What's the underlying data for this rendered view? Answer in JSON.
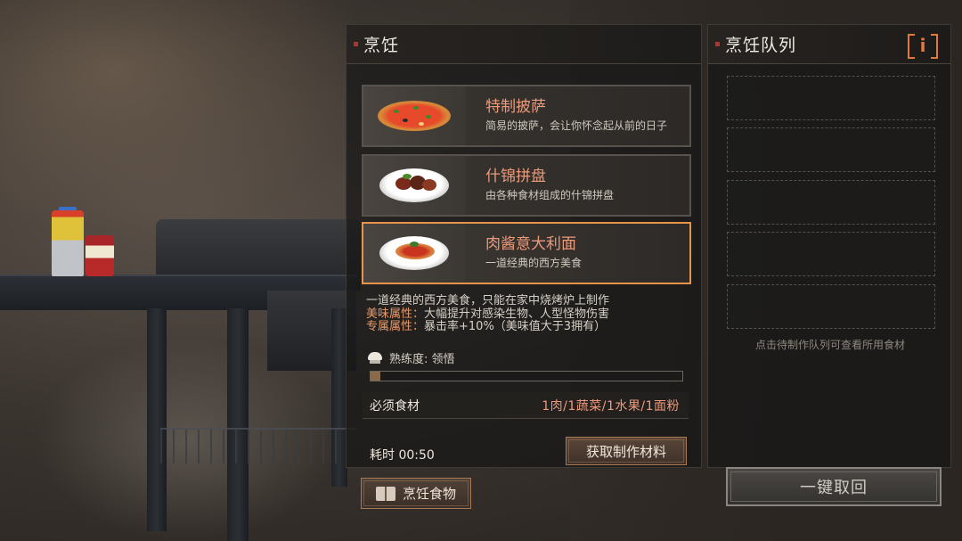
{
  "cook_panel": {
    "title": "烹饪",
    "recipes": [
      {
        "name": "特制披萨",
        "desc": "简易的披萨，会让你怀念起从前的日子",
        "icon": "pizza-icon",
        "selected": false
      },
      {
        "name": "什锦拼盘",
        "desc": "由各种食材组成的什锦拼盘",
        "icon": "platter-icon",
        "selected": false
      },
      {
        "name": "肉酱意大利面",
        "desc": "一道经典的西方美食",
        "icon": "spaghetti-icon",
        "selected": true
      }
    ],
    "detail": {
      "description": "一道经典的西方美食，只能在家中烧烤炉上制作",
      "attr1_label": "美味属性：",
      "attr1_value": "大幅提升对感染生物、人型怪物伤害",
      "attr2_label": "专属属性：",
      "attr2_value": "暴击率+10%（美味值大于3拥有）"
    },
    "proficiency": {
      "label": "熟练度: 领悟",
      "progress": 0.03
    },
    "ingredients": {
      "label": "必须食材",
      "value": "1肉/1蔬菜/1水果/1面粉"
    },
    "time": "耗时 00:50",
    "get_materials_button": "获取制作材料",
    "cook_button": "烹饪食物"
  },
  "queue_panel": {
    "title": "烹饪队列",
    "info_button": "i",
    "slots": 5,
    "hint": "点击待制作队列可查看所用食材",
    "retrieve_button": "一键取回"
  },
  "colors": {
    "accent_orange": "#e5944a",
    "recipe_name": "#ec9a7a",
    "attr_label": "#e89a6a"
  }
}
